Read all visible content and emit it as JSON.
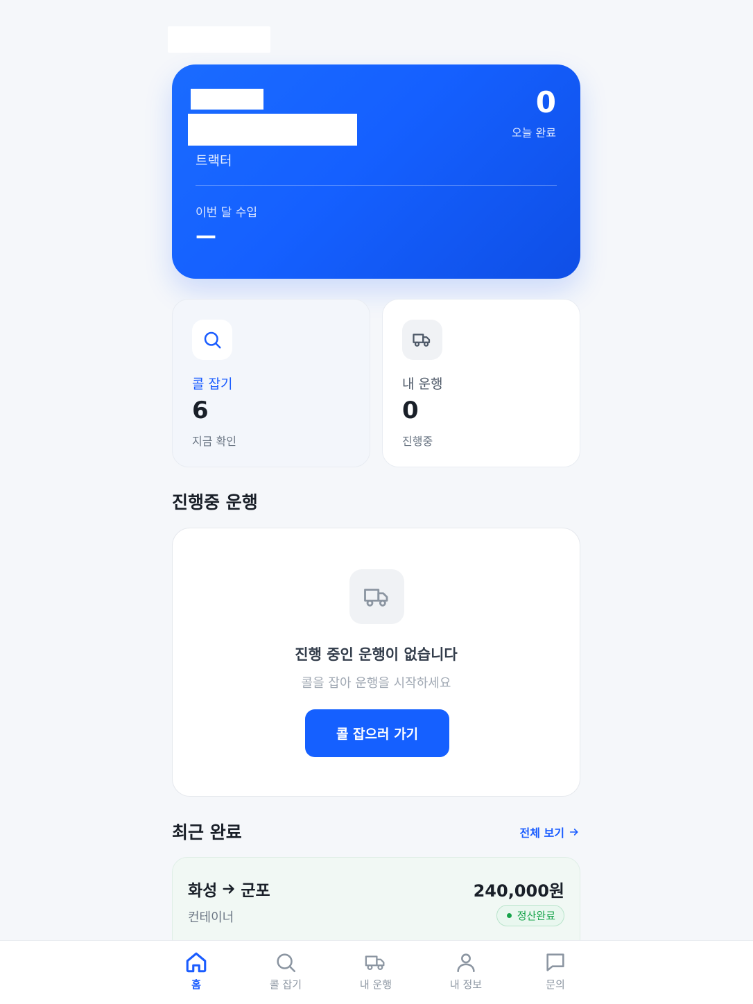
{
  "hero": {
    "vehicle_type": "트랙터",
    "today_count": "0",
    "today_label": "오늘 완료",
    "income_label": "이번 달 수입",
    "income_value": "—"
  },
  "stats": [
    {
      "title": "콜 잡기",
      "value": "6",
      "sub": "지금 확인",
      "icon": "search-icon"
    },
    {
      "title": "내 운행",
      "value": "0",
      "sub": "진행중",
      "icon": "truck-icon"
    }
  ],
  "active": {
    "section_title": "진행중 운행",
    "empty_title": "진행 중인 운행이 없습니다",
    "empty_hint": "콜을 잡아 운행을 시작하세요",
    "cta_label": "콜 잡으러 가기"
  },
  "recent": {
    "section_title": "최근 완료",
    "view_all": "전체 보기",
    "items": [
      {
        "from": "화성",
        "to": "군포",
        "type": "컨테이너",
        "price": "240,000원",
        "status": "정산완료"
      }
    ]
  },
  "nav": {
    "items": [
      {
        "label": "홈",
        "icon": "home-icon",
        "active": true
      },
      {
        "label": "콜 잡기",
        "icon": "search-icon"
      },
      {
        "label": "내 운행",
        "icon": "truck-icon"
      },
      {
        "label": "내 정보",
        "icon": "user-icon"
      },
      {
        "label": "문의",
        "icon": "chat-icon"
      }
    ]
  },
  "colors": {
    "primary": "#1560ff",
    "success": "#16a34a",
    "text": "#191f28",
    "muted": "#6b7684"
  }
}
